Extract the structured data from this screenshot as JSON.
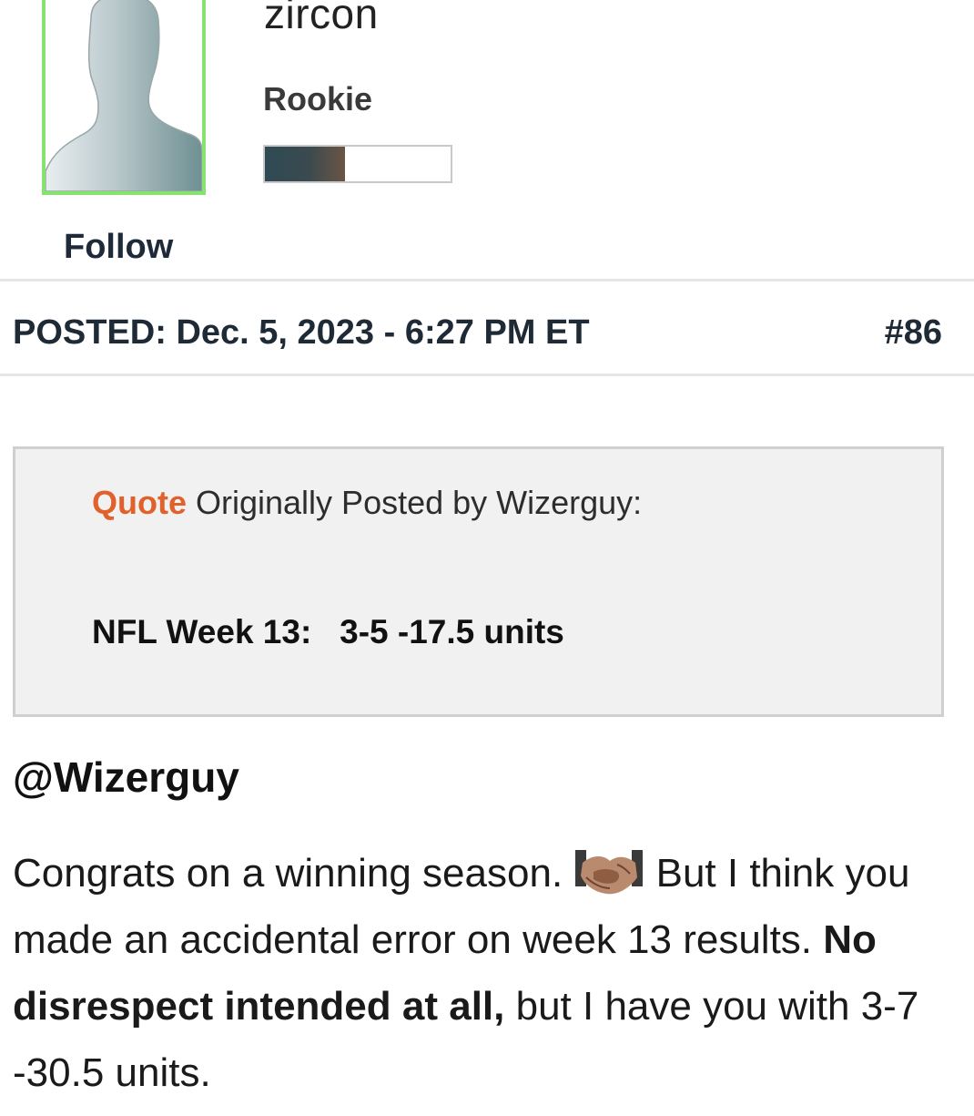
{
  "author": {
    "username": "zircon",
    "rank": "Rookie",
    "rank_progress": 0.43,
    "follow_label": "Follow",
    "avatar_icon": "default-avatar-silhouette",
    "avatar_border_color": "#86e36e"
  },
  "post": {
    "posted_label": "POSTED: Dec. 5, 2023 - 6:27 PM ET",
    "post_number": "#86"
  },
  "quote": {
    "label": "Quote",
    "attribution": " Originally Posted by Wizerguy:",
    "body": "NFL Week 13:   3-5 -17.5 units",
    "label_color": "#e0612b"
  },
  "reply": {
    "mention": "@Wizerguy",
    "text_1": " Congrats on a winning season. ",
    "emoji_icon": "handshake-icon",
    "text_2": " But I think you made an accidental error on week 13 results. ",
    "bold_text": "No disrespect intended at all,",
    "text_3": " but I have you with 3-7 -30.5 units."
  }
}
